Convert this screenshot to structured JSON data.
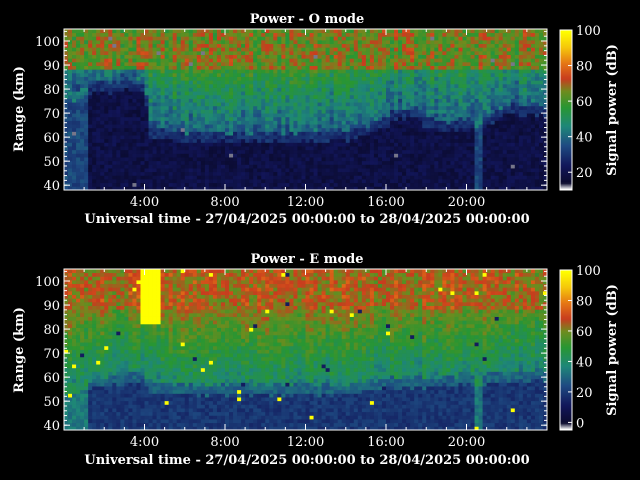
{
  "chart_data": [
    {
      "type": "heatmap",
      "title": "Power - O mode",
      "xlabel": "Universal time - 27/04/2025 00:00:00 to 28/04/2025 00:00:00",
      "ylabel": "Range (km)",
      "x_ticks": [
        "4:00",
        "8:00",
        "12:00",
        "16:00",
        "20:00"
      ],
      "x_tick_hours": [
        4,
        8,
        12,
        16,
        20
      ],
      "xlim_hours": [
        0,
        24
      ],
      "y_ticks": [
        40,
        50,
        60,
        70,
        80,
        90,
        100
      ],
      "ylim": [
        38,
        105
      ],
      "colorbar": {
        "label": "Signal power (dB)",
        "ticks": [
          20,
          40,
          60,
          80,
          100
        ],
        "range": [
          10,
          100
        ]
      },
      "features": {
        "low_power_floor_km": [
          [
            0,
            79
          ],
          [
            2,
            83
          ],
          [
            4,
            83
          ],
          [
            4.3,
            64
          ],
          [
            6,
            62
          ],
          [
            8,
            62
          ],
          [
            10,
            62
          ],
          [
            12,
            62
          ],
          [
            14,
            63
          ],
          [
            15,
            65
          ],
          [
            16.5,
            71
          ],
          [
            17.5,
            73
          ],
          [
            18,
            68
          ],
          [
            19,
            67
          ],
          [
            20,
            67
          ],
          [
            21,
            69
          ],
          [
            22,
            73
          ],
          [
            24,
            73
          ]
        ],
        "base_power_db": 38,
        "upper_power_db": 62
      }
    },
    {
      "type": "heatmap",
      "title": "Power - E mode",
      "xlabel": "Universal time - 27/04/2025 00:00:00 to 28/04/2025 00:00:00",
      "ylabel": "Range (km)",
      "x_ticks": [
        "4:00",
        "8:00",
        "12:00",
        "16:00",
        "20:00"
      ],
      "x_tick_hours": [
        4,
        8,
        12,
        16,
        20
      ],
      "xlim_hours": [
        0,
        24
      ],
      "y_ticks": [
        40,
        50,
        60,
        70,
        80,
        90,
        100
      ],
      "ylim": [
        38,
        105
      ],
      "colorbar": {
        "label": "Signal power (dB)",
        "ticks": [
          0,
          20,
          40,
          60,
          80,
          100
        ],
        "range": [
          -5,
          100
        ]
      },
      "features": {
        "low_power_floor_km": [
          [
            0,
            56
          ],
          [
            2,
            60
          ],
          [
            3.5,
            62
          ],
          [
            4,
            62
          ],
          [
            4.3,
            58
          ],
          [
            6,
            57
          ],
          [
            8,
            57
          ],
          [
            10,
            57
          ],
          [
            12,
            57
          ],
          [
            14,
            57
          ],
          [
            15.5,
            58
          ],
          [
            16.5,
            60
          ],
          [
            18,
            60
          ],
          [
            20,
            61
          ],
          [
            22,
            62
          ],
          [
            24,
            62
          ]
        ],
        "base_power_db": 38,
        "upper_power_db": 62
      }
    }
  ]
}
